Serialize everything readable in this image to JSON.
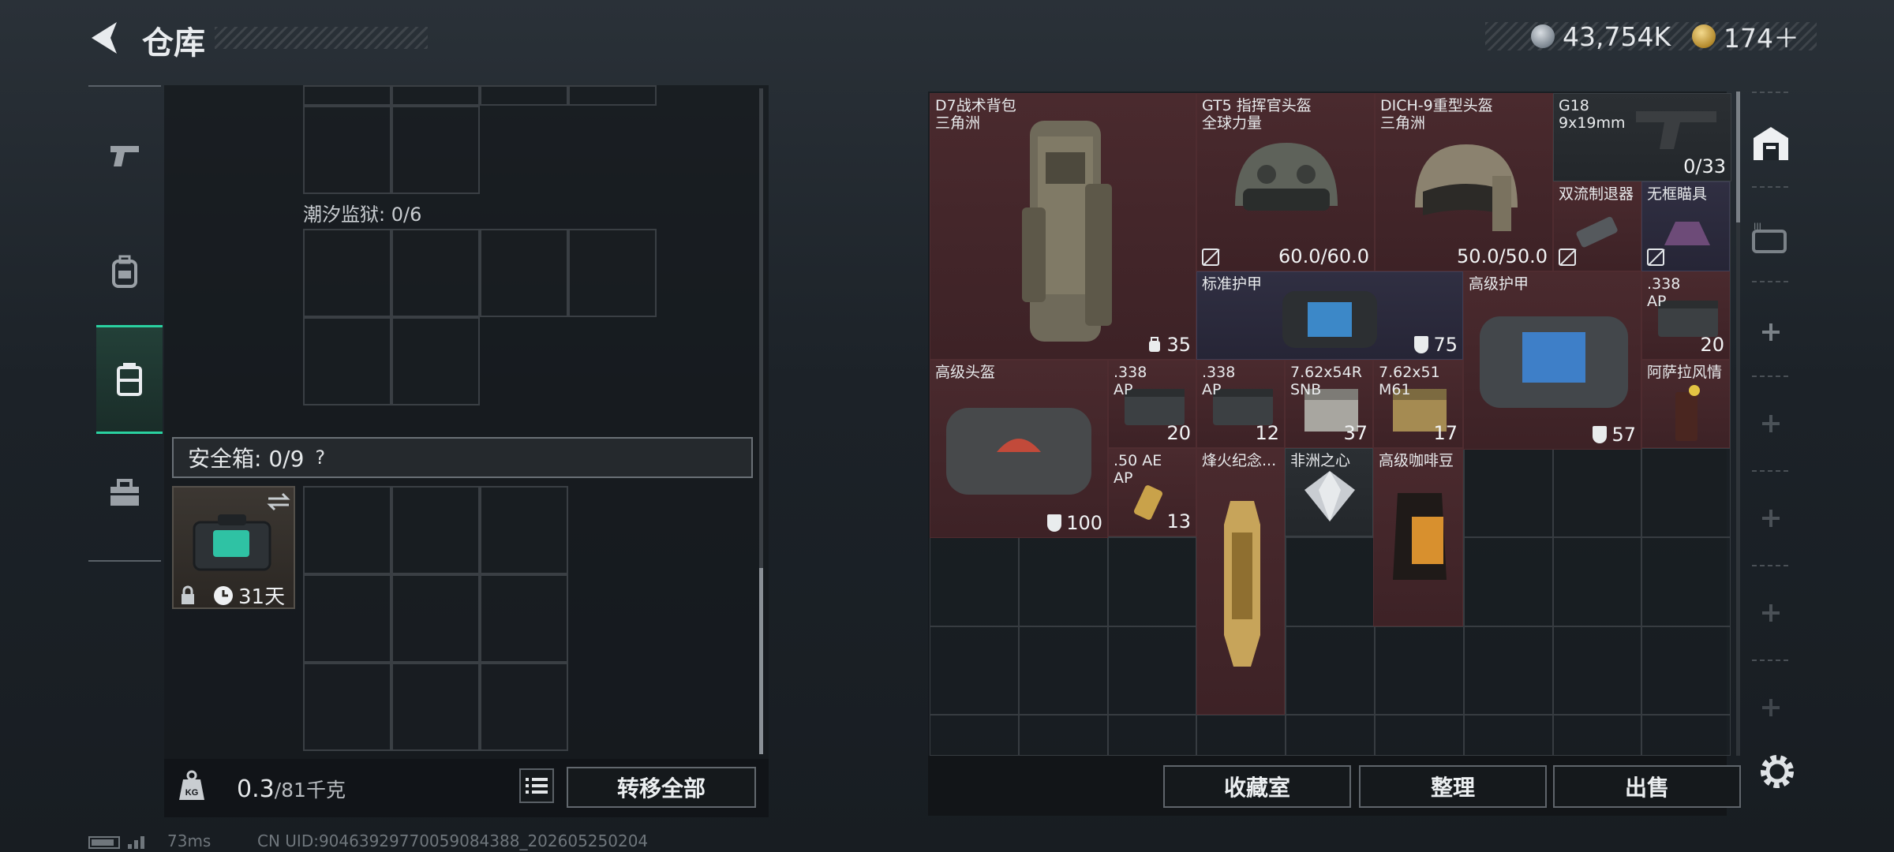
{
  "header": {
    "title": "仓库"
  },
  "currency": {
    "silver": "43,754K",
    "gold": "174＋"
  },
  "left": {
    "prison_label": "潮汐监狱: 0/6",
    "safe_label": "安全箱: 0/9",
    "safe_help": "?",
    "safebox_timer": "31天",
    "weight_current": "0.3",
    "weight_max": "/81千克",
    "transfer_all": "转移全部"
  },
  "items": [
    {
      "name": "D7战术背包\n三角洲",
      "value": "35"
    },
    {
      "name": "GT5 指挥官头盔\n全球力量",
      "value": "60.0/60.0"
    },
    {
      "name": "DICH-9重型头盔\n三角洲",
      "value": "50.0/50.0"
    },
    {
      "name": "G18\n9x19mm",
      "value": "0/33"
    },
    {
      "name": "双流制退器",
      "value": ""
    },
    {
      "name": "无框瞄具",
      "value": ""
    },
    {
      "name": "标准护甲",
      "value": "75"
    },
    {
      "name": "高级护甲",
      "value": "57"
    },
    {
      "name": ".338\nAP",
      "value": "20"
    },
    {
      "name": "高级头盔",
      "value": "100"
    },
    {
      "name": ".338\nAP",
      "value": "20"
    },
    {
      "name": ".338\nAP",
      "value": "12"
    },
    {
      "name": "7.62x54R\nSNB",
      "value": "37"
    },
    {
      "name": "7.62x51\nM61",
      "value": "17"
    },
    {
      "name": "阿萨拉风情",
      "value": ""
    },
    {
      "name": ".50 AE\nAP",
      "value": "13"
    },
    {
      "name": "烽火纪念...",
      "value": ""
    },
    {
      "name": "非洲之心",
      "value": ""
    },
    {
      "name": "高级咖啡豆",
      "value": ""
    }
  ],
  "actions": {
    "collection": "收藏室",
    "sort": "整理",
    "sell": "出售"
  },
  "status": {
    "ping": "73ms",
    "uid": "CN UID:9046392977005908438​8_202605250204"
  }
}
